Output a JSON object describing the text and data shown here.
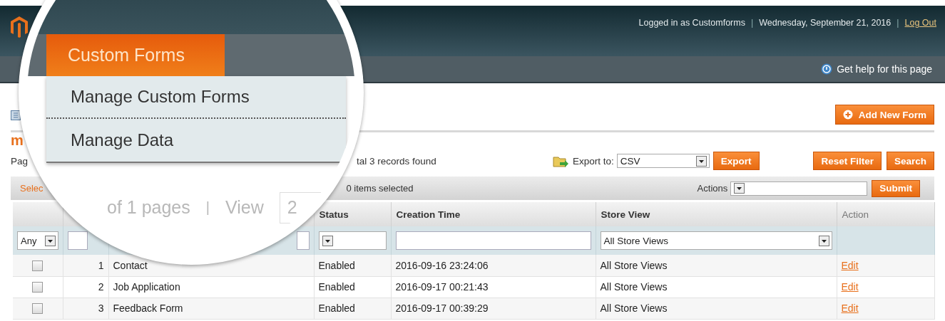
{
  "header": {
    "items": [
      {
        "kind": "text",
        "text": "Logged in as Customforms"
      },
      {
        "kind": "separator",
        "text": "|"
      },
      {
        "kind": "text",
        "text": "Wednesday, September 21, 2016"
      },
      {
        "kind": "separator",
        "text": "|"
      },
      {
        "kind": "link",
        "text": "Log Out"
      }
    ]
  },
  "help_link": "Get help for this page",
  "add_button": "Add New Form",
  "page_title_fragment": "m",
  "toolbar": {
    "pager_fragment": "Pag",
    "records": "tal 3 records found",
    "export_label": "Export to:",
    "export_value": "CSV",
    "export_button": "Export",
    "reset_button": "Reset Filter",
    "search_button": "Search"
  },
  "massaction": {
    "select_fragment": "Selec",
    "selected_count": "0 items selected",
    "actions_label": "Actions",
    "submit_button": "Submit"
  },
  "table": {
    "columns": [
      {
        "label": "Status"
      },
      {
        "label": "Creation Time"
      },
      {
        "label": "Store View"
      },
      {
        "label": "Action"
      }
    ],
    "filters": {
      "checkbox_filter": "Any",
      "store_view": "All Store Views"
    },
    "rows": [
      {
        "checked": false,
        "id": "1",
        "name": "Contact",
        "status": "Enabled",
        "created": "2016-09-16 23:24:06",
        "store_view": "All Store Views",
        "action": "Edit"
      },
      {
        "checked": false,
        "id": "2",
        "name": "Job Application",
        "status": "Enabled",
        "created": "2016-09-17 00:21:43",
        "store_view": "All Store Views",
        "action": "Edit"
      },
      {
        "checked": false,
        "id": "3",
        "name": "Feedback Form",
        "status": "Enabled",
        "created": "2016-09-17 00:39:29",
        "store_view": "All Store Views",
        "action": "Edit"
      }
    ]
  },
  "magnifier": {
    "menu_tab": "Custom Forms",
    "menu_items": [
      "Manage Custom Forms",
      "Manage Data"
    ],
    "pager_text": "of 1 pages",
    "separator": "|",
    "view_label": "View",
    "view_value": "2"
  }
}
